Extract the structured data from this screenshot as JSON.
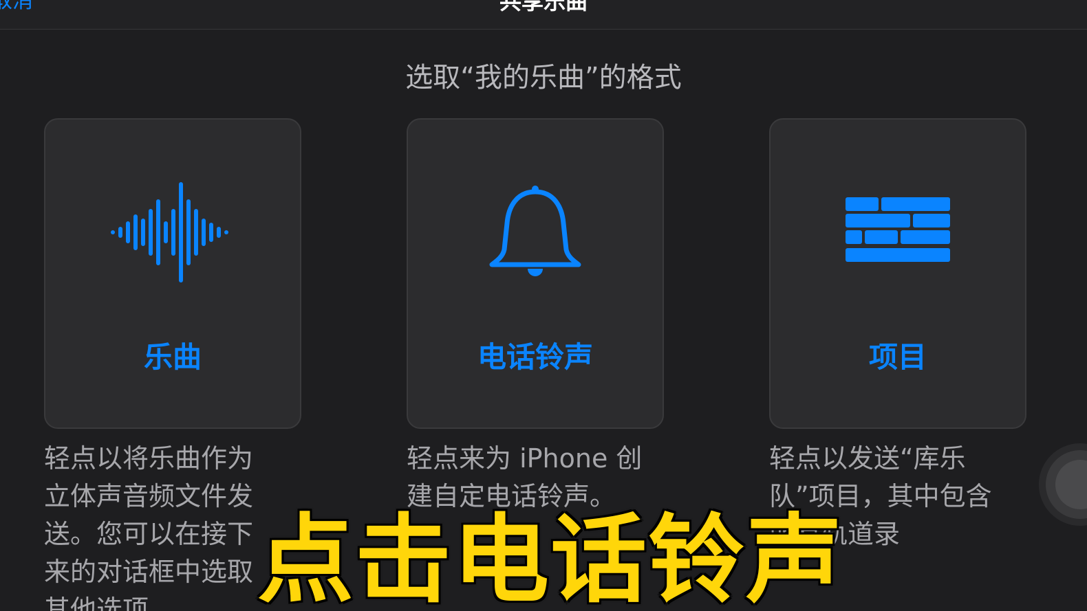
{
  "navbar": {
    "cancel_label": "取消",
    "title": "共享乐曲"
  },
  "subtitle": "选取“我的乐曲”的格式",
  "options": [
    {
      "icon": "waveform-icon",
      "label": "乐曲",
      "description": "轻点以将乐曲作为\n立体声音频文件发\n送。您可以在接下\n来的对话框中选取\n其他选项。"
    },
    {
      "icon": "bell-icon",
      "label": "电话铃声",
      "description": "轻点来为 iPhone 创\n建自定电话铃声。"
    },
    {
      "icon": "project-blocks-icon",
      "label": "项目",
      "description": "轻点以发送“库乐\n队”项目，其中包含\n所有轨道录"
    }
  ],
  "caption": "点击电话铃声",
  "colors": {
    "accent": "#0a84ff",
    "background": "#1e1e20",
    "card": "#2c2c2e",
    "caption": "#ffd60a"
  }
}
